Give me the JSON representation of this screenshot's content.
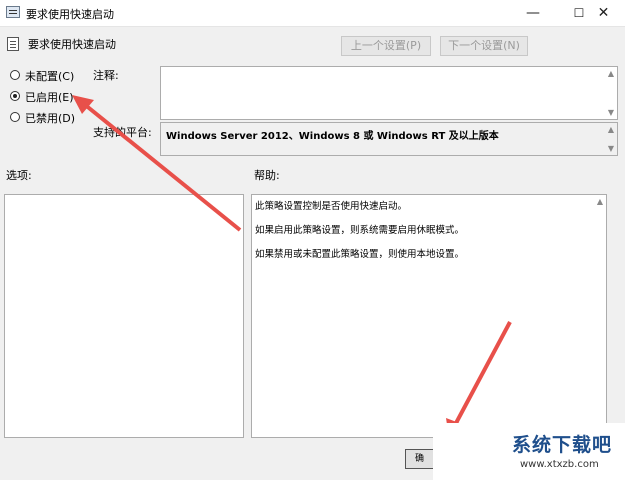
{
  "window": {
    "title": "要求使用快速启动",
    "minimize_glyph": "—",
    "maximize_glyph": "☐",
    "close_glyph": "✕"
  },
  "header": {
    "setting_name": "要求使用快速启动",
    "prev_button": "上一个设置(P)",
    "next_button": "下一个设置(N)"
  },
  "state": {
    "options": [
      {
        "label": "未配置(C)",
        "selected": false
      },
      {
        "label": "已启用(E)",
        "selected": true
      },
      {
        "label": "已禁用(D)",
        "selected": false
      }
    ]
  },
  "comment": {
    "label": "注释:",
    "value": ""
  },
  "supported": {
    "label": "支持的平台:",
    "value": "Windows Server 2012、Windows 8 或 Windows RT 及以上版本"
  },
  "options_section": {
    "label": "选项:"
  },
  "help_section": {
    "label": "帮助:",
    "lines": [
      "此策略设置控制是否使用快速启动。",
      "如果启用此策略设置，则系统需要启用休眠模式。",
      "如果禁用或未配置此策略设置，则使用本地设置。"
    ]
  },
  "footer": {
    "ok_button": "确"
  },
  "watermark": {
    "logo_text": "系统下载吧",
    "url": "www.xtxzb.com"
  },
  "colors": {
    "arrow": "#e8504a",
    "accent": "#1f4f8c"
  }
}
